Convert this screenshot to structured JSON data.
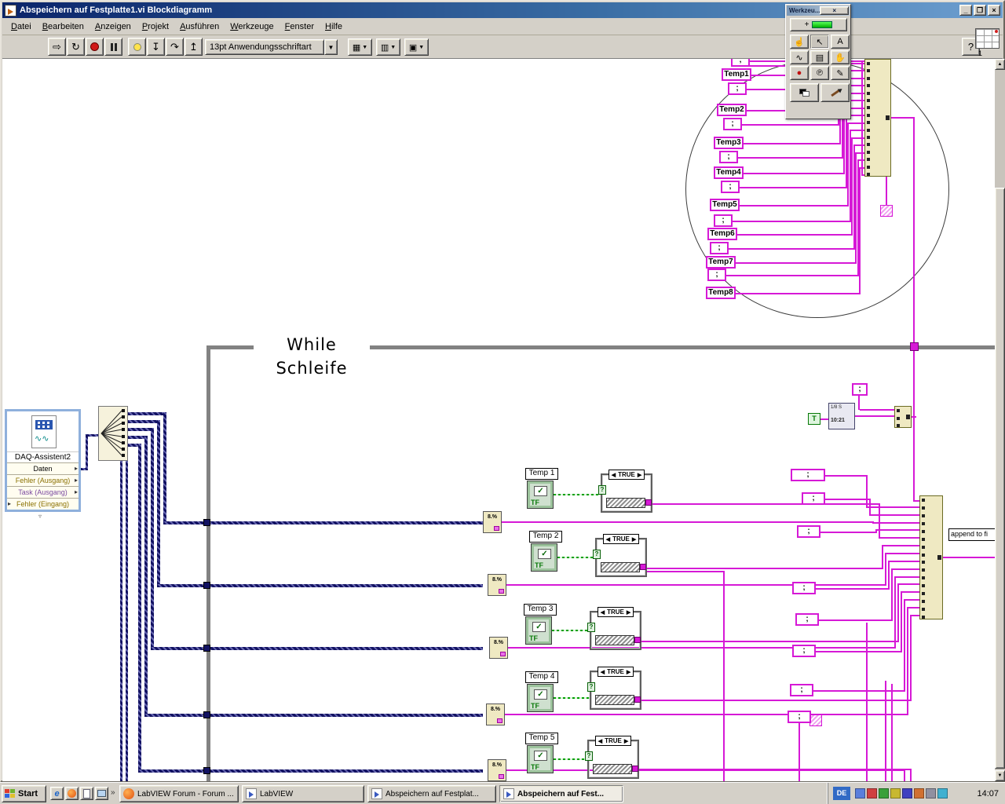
{
  "window": {
    "title": "Abspeichern auf Festplatte1.vi Blockdiagramm",
    "minimize": "_",
    "maximize": "❐",
    "close": "×"
  },
  "menu": [
    "Datei",
    "Bearbeiten",
    "Anzeigen",
    "Projekt",
    "Ausführen",
    "Werkzeuge",
    "Fenster",
    "Hilfe"
  ],
  "toolbar": {
    "font_selector": "13pt Anwendungsschriftart",
    "help": "?"
  },
  "palette": {
    "title": "Werkzeu...",
    "close": "×"
  },
  "diagram": {
    "while_label": "While Schleife",
    "daq": {
      "title": "DAQ-Assistent2",
      "ports": [
        {
          "label": "Daten",
          "color": "#000000"
        },
        {
          "label": "Fehler (Ausgang)",
          "color": "#8a7000"
        },
        {
          "label": "Task (Ausgang)",
          "color": "#7a4aa0"
        },
        {
          "label": "Fehler (Eingang)",
          "color": "#8a7000"
        }
      ]
    },
    "temp_constants": [
      "Temp1",
      "Temp2",
      "Temp3",
      "Temp4",
      "Temp5",
      "Temp6",
      "Temp7",
      "Temp8"
    ],
    "semicolon": ";",
    "channels": [
      "Temp 1",
      "Temp 2",
      "Temp 3",
      "Temp 4",
      "Temp 5"
    ],
    "tf_label": "TF",
    "check_glyph": "✓",
    "case_selector": "TRUE",
    "format_node_text": "8.%",
    "true_constant": "T",
    "time_node": {
      "line1": "1/8 S",
      "line2": "10:21"
    },
    "append_label": "append to fi",
    "wire_colors": {
      "string": "#d619d6",
      "dynamic": "#121262",
      "boolean": "#00a000"
    }
  },
  "misc": {
    "numpad_label": "1"
  },
  "taskbar": {
    "start": "Start",
    "quick_launch_overflow": "»",
    "tasks": [
      {
        "label": "LabVIEW Forum - Forum ...",
        "active": false
      },
      {
        "label": "LabVIEW",
        "active": false
      },
      {
        "label": "Abspeichern auf Festplat...",
        "active": false
      },
      {
        "label": "Abspeichern auf Fest...",
        "active": true
      }
    ],
    "language": "DE",
    "time": "14:07"
  }
}
